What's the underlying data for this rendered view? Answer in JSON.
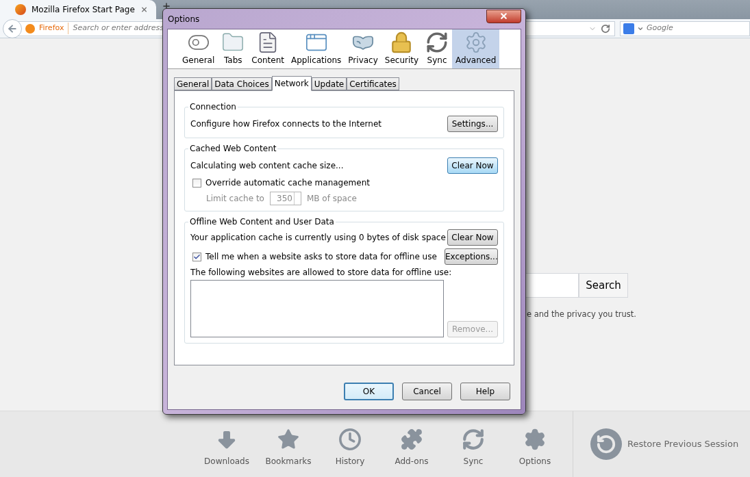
{
  "browser": {
    "tab": {
      "title": "Mozilla Firefox Start Page",
      "selected": true
    },
    "address_bar": {
      "identity": "Firefox",
      "placeholder": "Search or enter address"
    },
    "search_bar": {
      "placeholder": "Google"
    }
  },
  "page": {
    "search_button": "Search",
    "tagline": "e and the privacy you trust."
  },
  "launcher": {
    "items": [
      {
        "label": "Downloads",
        "kind": "downloads"
      },
      {
        "label": "Bookmarks",
        "kind": "bookmarks"
      },
      {
        "label": "History",
        "kind": "history"
      },
      {
        "label": "Add-ons",
        "kind": "addons"
      },
      {
        "label": "Sync",
        "kind": "sync"
      },
      {
        "label": "Options",
        "kind": "options"
      }
    ],
    "restore": "Restore Previous Session"
  },
  "dialog": {
    "title": "Options",
    "panes": [
      {
        "label": "General",
        "kind": "general",
        "selected": false
      },
      {
        "label": "Tabs",
        "kind": "tabs",
        "selected": false
      },
      {
        "label": "Content",
        "kind": "content",
        "selected": false
      },
      {
        "label": "Applications",
        "kind": "applications",
        "selected": false
      },
      {
        "label": "Privacy",
        "kind": "privacy",
        "selected": false
      },
      {
        "label": "Security",
        "kind": "security",
        "selected": false
      },
      {
        "label": "Sync",
        "kind": "sync",
        "selected": false
      },
      {
        "label": "Advanced",
        "kind": "advanced",
        "selected": true
      }
    ],
    "tabs": [
      {
        "label": "General",
        "selected": false
      },
      {
        "label": "Data Choices",
        "selected": false
      },
      {
        "label": "Network",
        "selected": true
      },
      {
        "label": "Update",
        "selected": false
      },
      {
        "label": "Certificates",
        "selected": false
      }
    ],
    "connection": {
      "title": "Connection",
      "text": "Configure how Firefox connects to the Internet",
      "button": {
        "label": "Settings...",
        "hot": false,
        "disabled": false
      }
    },
    "cache": {
      "title": "Cached Web Content",
      "status": "Calculating web content cache size...",
      "button": {
        "label": "Clear Now",
        "hot": true,
        "disabled": false
      },
      "override": {
        "label": "Override automatic cache management",
        "checked": false
      },
      "limit": {
        "label": "Limit cache to",
        "value": "350",
        "unit": "MB of space",
        "disabled": true
      }
    },
    "offline": {
      "title": "Offline Web Content and User Data",
      "usage": "Your application cache is currently using 0 bytes of disk space",
      "clear_button": {
        "label": "Clear Now",
        "hot": false,
        "disabled": false
      },
      "notify": {
        "label": "Tell me when a website asks to store data for offline use",
        "checked": true
      },
      "exceptions_button": {
        "label": "Exceptions...",
        "hot": false,
        "disabled": false
      },
      "list_label": "The following websites are allowed to store data for offline use:",
      "remove_button": {
        "label": "Remove...",
        "hot": false,
        "disabled": true
      }
    },
    "buttons": [
      {
        "label": "OK",
        "default": true
      },
      {
        "label": "Cancel",
        "default": false
      },
      {
        "label": "Help",
        "default": false
      }
    ]
  }
}
